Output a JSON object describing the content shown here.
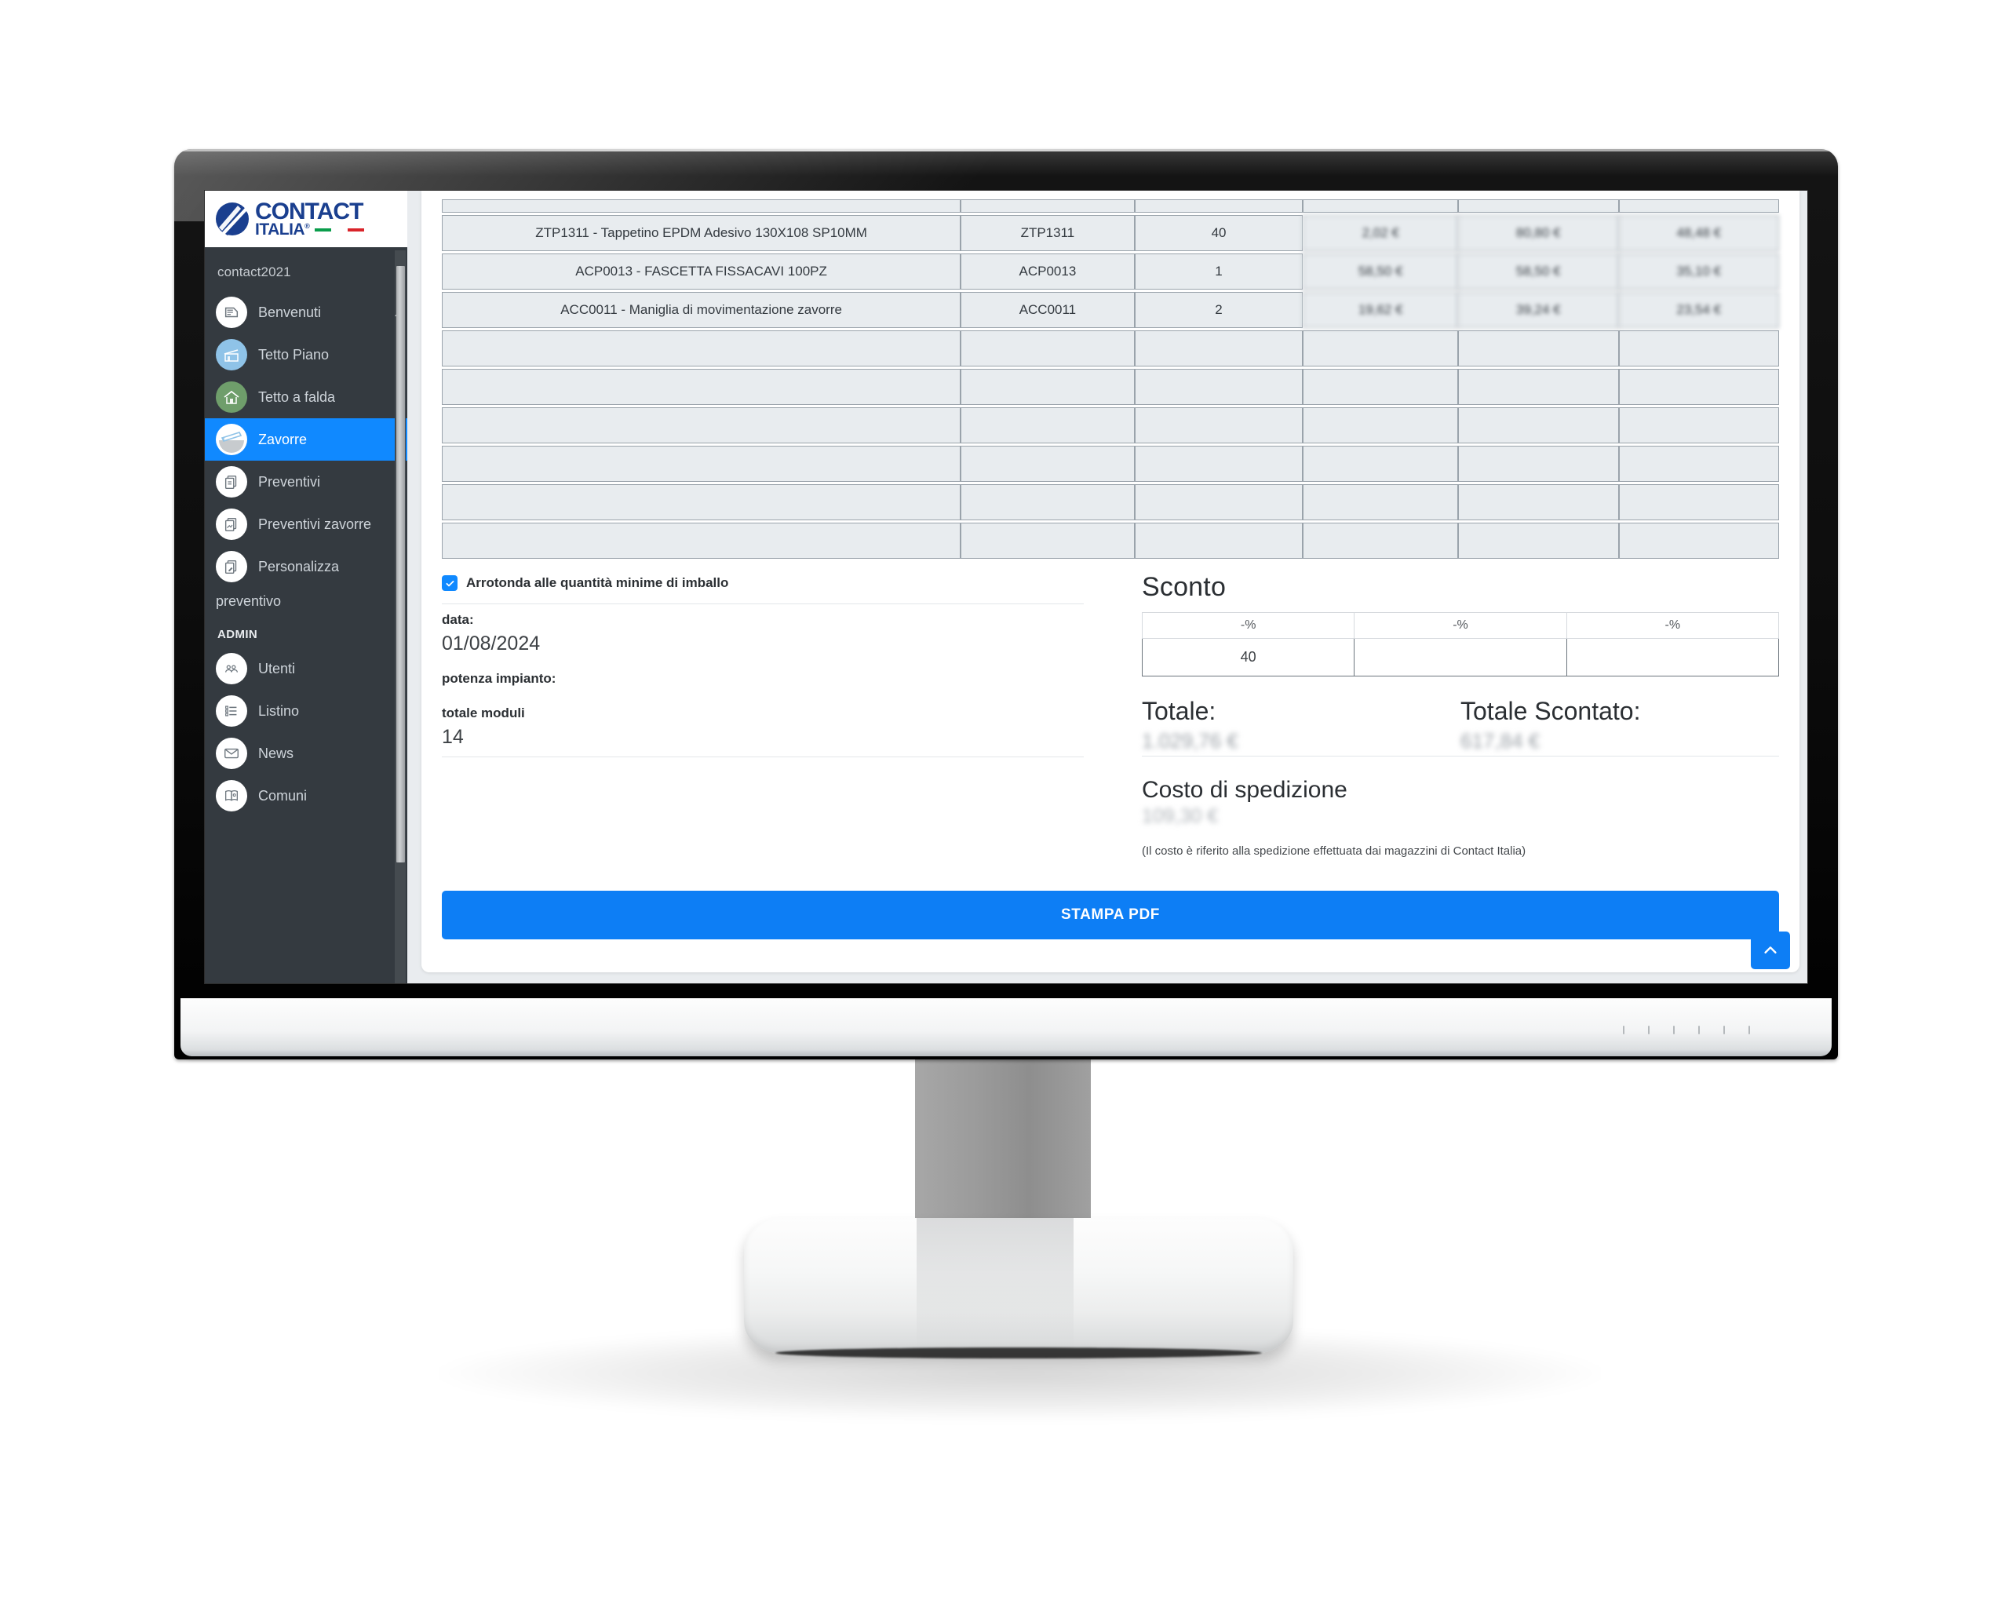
{
  "brand": {
    "name_top": "CONTACT",
    "name_bottom": "ITALIA",
    "registered": "®"
  },
  "sidebar": {
    "user": "contact2021",
    "admin_section_label": "ADMIN",
    "items": [
      {
        "label": "Benvenuti",
        "icon": "welcome-icon",
        "active": false
      },
      {
        "label": "Tetto Piano",
        "icon": "flat-roof-icon",
        "active": false
      },
      {
        "label": "Tetto a falda",
        "icon": "pitched-roof-icon",
        "active": false
      },
      {
        "label": "Zavorre",
        "icon": "ballast-icon",
        "active": true
      },
      {
        "label": "Preventivi",
        "icon": "documents-icon",
        "active": false
      },
      {
        "label": "Preventivi zavorre",
        "icon": "documents-icon",
        "active": false
      },
      {
        "label": "Personalizza preventivo",
        "icon": "documents-edit-icon",
        "active": false
      }
    ],
    "admin_items": [
      {
        "label": "Utenti",
        "icon": "users-icon"
      },
      {
        "label": "Listino",
        "icon": "list-icon"
      },
      {
        "label": "News",
        "icon": "mail-icon"
      },
      {
        "label": "Comuni",
        "icon": "map-book-icon"
      }
    ]
  },
  "table": {
    "rows": [
      {
        "desc": "ZTP1311 - Tappetino EPDM Adesivo 130X108 SP10MM",
        "code": "ZTP1311",
        "qty": "40",
        "unit": "2,02 €",
        "total": "80,80 €",
        "net": "48,48 €"
      },
      {
        "desc": "ACP0013 - FASCETTA FISSACAVI 100PZ",
        "code": "ACP0013",
        "qty": "1",
        "unit": "58,50 €",
        "total": "58,50 €",
        "net": "35,10 €"
      },
      {
        "desc": "ACC0011 - Maniglia di movimentazione zavorre",
        "code": "ACC0011",
        "qty": "2",
        "unit": "19,62 €",
        "total": "39,24 €",
        "net": "23,54 €"
      }
    ],
    "empty_row_count": 6
  },
  "form": {
    "roundup_label": "Arrotonda alle quantità minime di imballo",
    "roundup_checked": true,
    "fields": [
      {
        "label": "data:",
        "value": "01/08/2024"
      },
      {
        "label": "potenza impianto:",
        "value": ""
      },
      {
        "label": "totale moduli",
        "value": "14"
      }
    ]
  },
  "discount": {
    "title": "Sconto",
    "headers": [
      "-%",
      "-%",
      "-%"
    ],
    "values": [
      "40",
      "",
      ""
    ]
  },
  "totals": {
    "total_label": "Totale:",
    "total_value": "1.029,76 €",
    "discounted_label": "Totale Scontato:",
    "discounted_value": "617,84 €"
  },
  "shipping": {
    "title": "Costo di spedizione",
    "value": "109,30 €",
    "note": "(Il costo è riferito alla spedizione effettuata dai magazzini di Contact Italia)"
  },
  "actions": {
    "print_pdf": "STAMPA PDF",
    "scroll_top_icon": "chevron-up-icon"
  },
  "colors": {
    "accent_blue": "#0d7ef5",
    "sidebar_bg": "#343a40",
    "active_nav": "#1089ff",
    "brand_blue": "#1a3f8f",
    "flag_green": "#0a9d4b",
    "flag_red": "#d9242a"
  }
}
